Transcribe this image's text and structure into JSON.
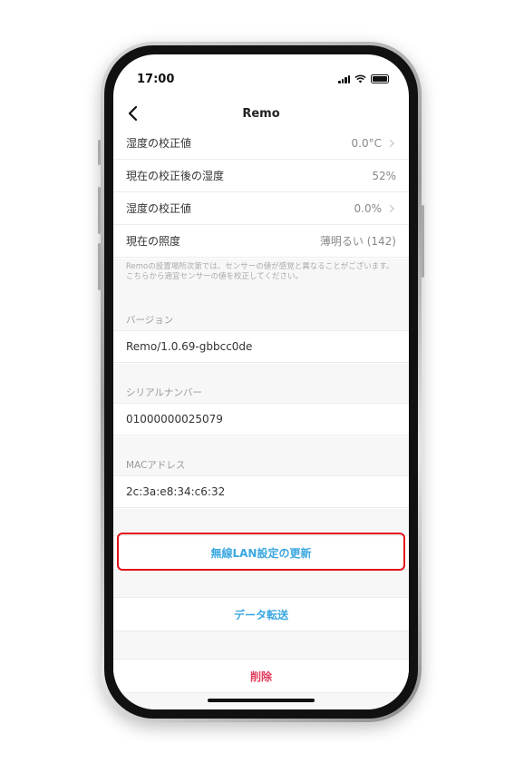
{
  "status_bar": {
    "time": "17:00"
  },
  "nav": {
    "title": "Remo"
  },
  "settings": [
    {
      "label": "湿度の校正値",
      "value": "0.0°C",
      "chevron": true
    },
    {
      "label": "現在の校正後の湿度",
      "value": "52%",
      "chevron": false
    },
    {
      "label": "湿度の校正値",
      "value": "0.0%",
      "chevron": true
    },
    {
      "label": "現在の照度",
      "value": "薄明るい (142)",
      "chevron": false
    }
  ],
  "note": "Remoの設置場所次第では、センサーの値が感覚と異なることがございます。こちらから適宜センサーの値を校正してください。",
  "version": {
    "header": "バージョン",
    "value": "Remo/1.0.69-gbbcc0de"
  },
  "serial": {
    "header": "シリアルナンバー",
    "value": "01000000025079"
  },
  "mac": {
    "header": "MACアドレス",
    "value": "2c:3a:e8:34:c6:32"
  },
  "actions": {
    "wifi_update": "無線LAN設定の更新",
    "data_transfer": "データ転送",
    "delete": "削除"
  },
  "colors": {
    "accent_blue": "#3aa7e0",
    "danger_red": "#e33a5b",
    "highlight": "#e3101a"
  }
}
